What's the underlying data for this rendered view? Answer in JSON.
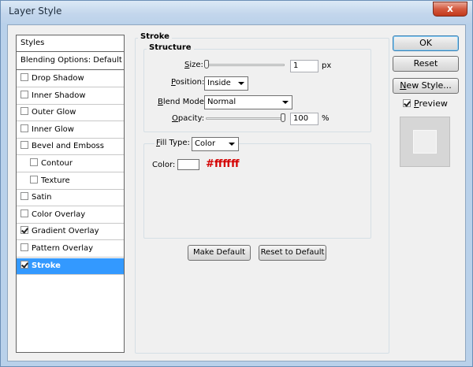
{
  "window": {
    "title": "Layer Style",
    "close_glyph": "x"
  },
  "styles_list": {
    "header": "Styles",
    "blending": "Blending Options: Default",
    "items": [
      {
        "label": "Drop Shadow",
        "checked": false,
        "indent": false
      },
      {
        "label": "Inner Shadow",
        "checked": false,
        "indent": false
      },
      {
        "label": "Outer Glow",
        "checked": false,
        "indent": false
      },
      {
        "label": "Inner Glow",
        "checked": false,
        "indent": false
      },
      {
        "label": "Bevel and Emboss",
        "checked": false,
        "indent": false
      },
      {
        "label": "Contour",
        "checked": false,
        "indent": true
      },
      {
        "label": "Texture",
        "checked": false,
        "indent": true
      },
      {
        "label": "Satin",
        "checked": false,
        "indent": false
      },
      {
        "label": "Color Overlay",
        "checked": false,
        "indent": false
      },
      {
        "label": "Gradient Overlay",
        "checked": true,
        "indent": false
      },
      {
        "label": "Pattern Overlay",
        "checked": false,
        "indent": false
      },
      {
        "label": "Stroke",
        "checked": true,
        "indent": false,
        "selected": true
      }
    ]
  },
  "stroke": {
    "group_title": "Stroke",
    "structure_title": "Structure",
    "size_label_u": "S",
    "size_label_rest": "ize:",
    "size_value": "1",
    "size_unit": "px",
    "size_slider_fraction": 0.0,
    "position_label_u": "P",
    "position_label_rest": "osition:",
    "position_value": "Inside",
    "blend_label_u": "B",
    "blend_label_rest": "lend Mode:",
    "blend_value": "Normal",
    "opacity_label_u": "O",
    "opacity_label_rest": "pacity:",
    "opacity_value": "100",
    "opacity_unit": "%",
    "opacity_slider_fraction": 1.0,
    "fill_type_label_u": "F",
    "fill_type_label_rest": "ill Type:",
    "fill_type_value": "Color",
    "color_label": "Color:",
    "color_swatch": "#ffffff",
    "color_annotation": "#ffffff",
    "make_default": "Make Default",
    "reset_default": "Reset to Default"
  },
  "actions": {
    "ok": "OK",
    "reset": "Reset",
    "new_style_u": "N",
    "new_style_rest": "ew Style...",
    "preview_u": "P",
    "preview_rest": "review",
    "preview_checked": true
  }
}
